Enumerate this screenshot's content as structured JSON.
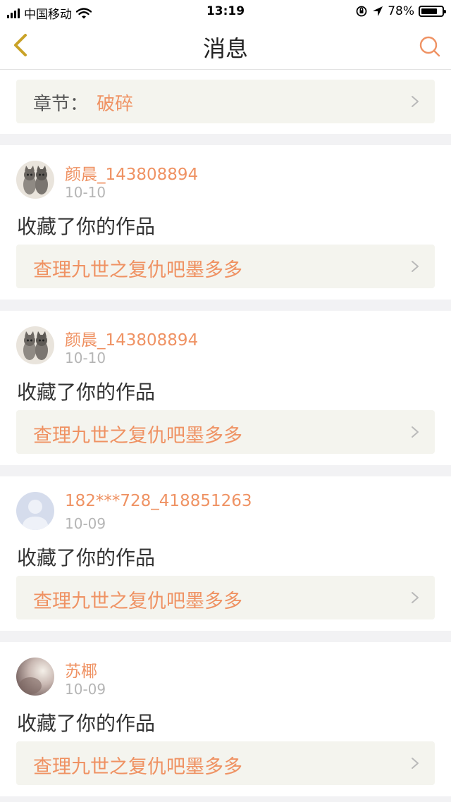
{
  "status_bar": {
    "carrier": "中国移动",
    "time": "13:19",
    "battery_percent": "78%",
    "battery_level": 0.78
  },
  "nav": {
    "title": "消息",
    "back_icon": "chevron-left-icon",
    "search_icon": "search-icon",
    "accent_color": "#ef9263"
  },
  "chapter": {
    "label": "章节：",
    "name": "破碎"
  },
  "messages": [
    {
      "username": "颜晨_143808894",
      "date": "10-10",
      "action": "收藏了你的作品",
      "work_title": "查理九世之复仇吧墨多多",
      "avatar": "cat-avatar"
    },
    {
      "username": "颜晨_143808894",
      "date": "10-10",
      "action": "收藏了你的作品",
      "work_title": "查理九世之复仇吧墨多多",
      "avatar": "cat-avatar"
    },
    {
      "username": "182***728_418851263",
      "date": "10-09",
      "action": "收藏了你的作品",
      "work_title": "查理九世之复仇吧墨多多",
      "avatar": "default-avatar"
    },
    {
      "username": "苏椰",
      "date": "10-09",
      "action": "收藏了你的作品",
      "work_title": "查理九世之复仇吧墨多多",
      "avatar": "photo-avatar"
    }
  ]
}
